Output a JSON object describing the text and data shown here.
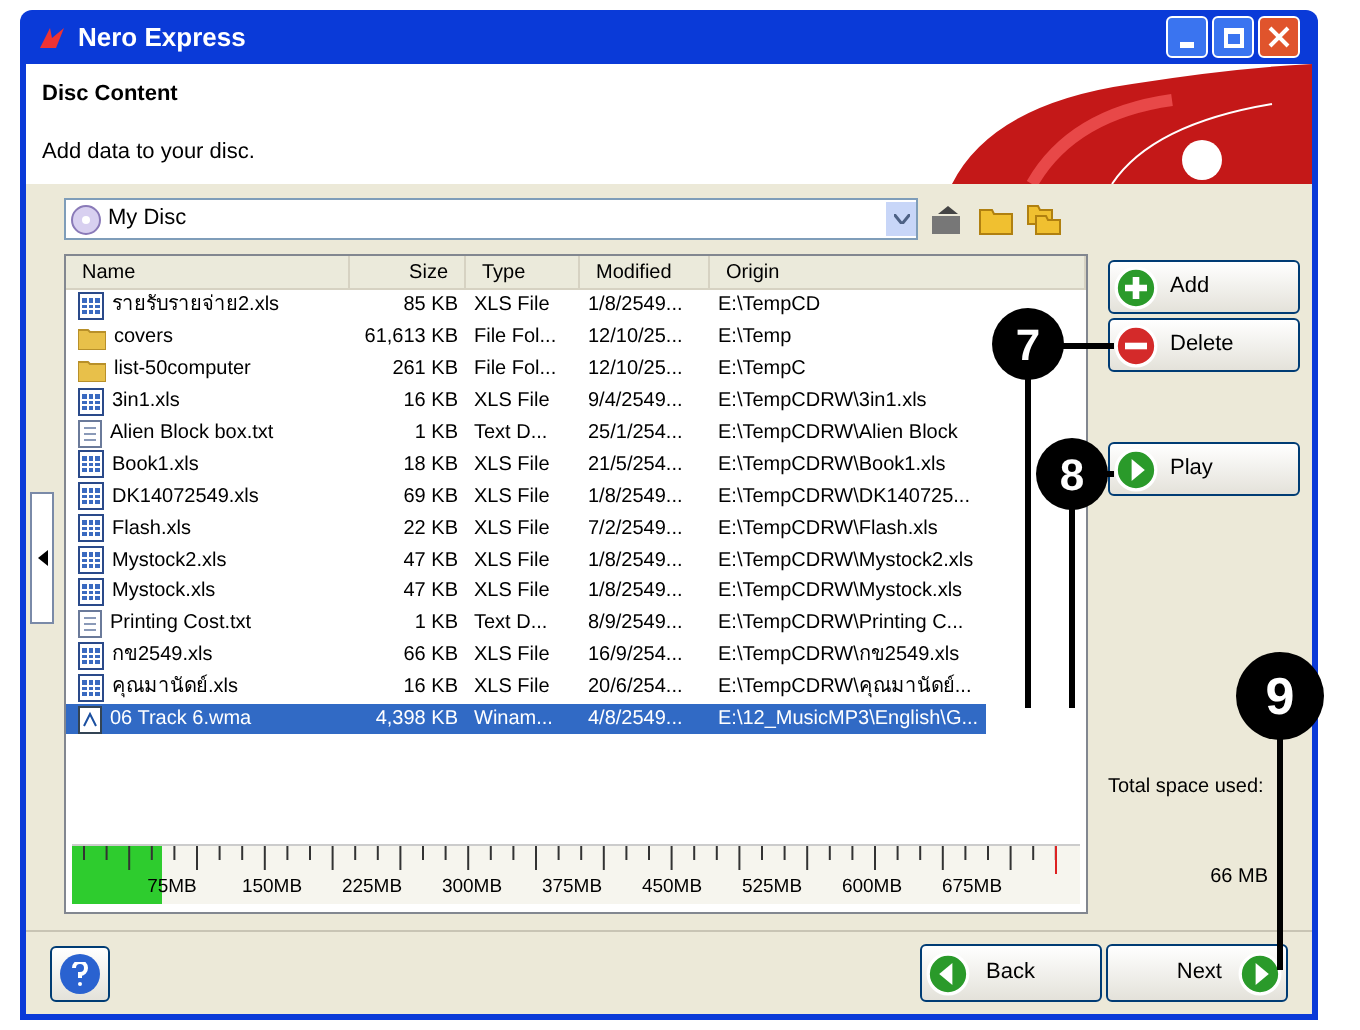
{
  "window": {
    "title": "Nero Express"
  },
  "header": {
    "title": "Disc Content",
    "subtitle": "Add data to your disc."
  },
  "disc_selector": {
    "value": "My Disc"
  },
  "table": {
    "columns": [
      "Name",
      "Size",
      "Type",
      "Modified",
      "Origin"
    ],
    "rows": [
      {
        "kind": "xls",
        "selected": false,
        "cells": [
          "รายรับรายจ่าย2.xls",
          "85 KB",
          "XLS File",
          "1/8/2549...",
          "E:\\TempCD"
        ]
      },
      {
        "kind": "folder",
        "selected": false,
        "cells": [
          "covers",
          "61,613 KB",
          "File Fol...",
          "12/10/25...",
          "E:\\Temp"
        ]
      },
      {
        "kind": "folder",
        "selected": false,
        "cells": [
          "list-50computer",
          "261 KB",
          "File Fol...",
          "12/10/25...",
          "E:\\TempC"
        ]
      },
      {
        "kind": "xls",
        "selected": false,
        "cells": [
          "3in1.xls",
          "16 KB",
          "XLS File",
          "9/4/2549...",
          "E:\\TempCDRW\\3in1.xls"
        ]
      },
      {
        "kind": "txt",
        "selected": false,
        "cells": [
          "Alien Block box.txt",
          "1 KB",
          "Text D...",
          "25/1/254...",
          "E:\\TempCDRW\\Alien Block"
        ]
      },
      {
        "kind": "xls",
        "selected": false,
        "cells": [
          "Book1.xls",
          "18 KB",
          "XLS File",
          "21/5/254...",
          "E:\\TempCDRW\\Book1.xls"
        ]
      },
      {
        "kind": "xls",
        "selected": false,
        "cells": [
          "DK14072549.xls",
          "69 KB",
          "XLS File",
          "1/8/2549...",
          "E:\\TempCDRW\\DK140725..."
        ]
      },
      {
        "kind": "xls",
        "selected": false,
        "cells": [
          "Flash.xls",
          "22 KB",
          "XLS File",
          "7/2/2549...",
          "E:\\TempCDRW\\Flash.xls"
        ]
      },
      {
        "kind": "xls",
        "selected": false,
        "cells": [
          "Mystock2.xls",
          "47 KB",
          "XLS File",
          "1/8/2549...",
          "E:\\TempCDRW\\Mystock2.xls"
        ]
      },
      {
        "kind": "xls",
        "selected": false,
        "cells": [
          "Mystock.xls",
          "47 KB",
          "XLS File",
          "1/8/2549...",
          "E:\\TempCDRW\\Mystock.xls"
        ]
      },
      {
        "kind": "txt",
        "selected": false,
        "cells": [
          "Printing Cost.txt",
          "1 KB",
          "Text D...",
          "8/9/2549...",
          "E:\\TempCDRW\\Printing C..."
        ]
      },
      {
        "kind": "xls",
        "selected": false,
        "cells": [
          "กข2549.xls",
          "66 KB",
          "XLS File",
          "16/9/254...",
          "E:\\TempCDRW\\กข2549.xls"
        ]
      },
      {
        "kind": "xls",
        "selected": false,
        "cells": [
          "คุณมานัดย์.xls",
          "16 KB",
          "XLS File",
          "20/6/254...",
          "E:\\TempCDRW\\คุณมานัดย์..."
        ]
      },
      {
        "kind": "wma",
        "selected": true,
        "cells": [
          "06 Track 6.wma",
          "4,398 KB",
          "Winam...",
          "4/8/2549...",
          "E:\\12_MusicMP3\\English\\G..."
        ]
      }
    ]
  },
  "capacity": {
    "level": 0.09,
    "ticks": [
      "75MB",
      "150MB",
      "225MB",
      "300MB",
      "375MB",
      "450MB",
      "525MB",
      "600MB",
      "675MB"
    ]
  },
  "side_buttons": [
    {
      "kind": "add",
      "label": "Add"
    },
    {
      "kind": "delete",
      "label": "Delete"
    },
    {
      "kind": "play",
      "label": "Play"
    }
  ],
  "total_space": {
    "label": "Total space used:",
    "value": "66 MB"
  },
  "nav_buttons": [
    {
      "kind": "back",
      "label": "Back"
    },
    {
      "kind": "next",
      "label": "Next"
    }
  ],
  "callouts": [
    "7",
    "8",
    "9"
  ]
}
